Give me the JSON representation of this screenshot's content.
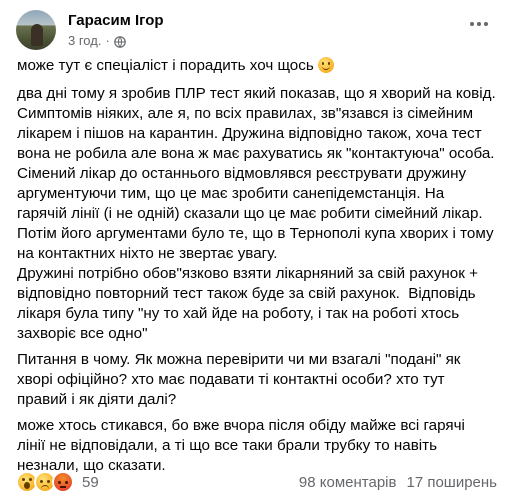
{
  "post": {
    "author": "Гарасим Ігор",
    "time": "3 год.",
    "separator": "·",
    "privacy_icon": "globe-icon",
    "more_icon": "more-options-icon",
    "paragraphs": [
      "може тут є спеціаліст і порадить хоч щось",
      "два дні тому я зробив ПЛР тест який показав, що я хворий на ковід. Симптомів ніяких, але я, по всіх правилах, зв\"язався із сімейним лікарем і пішов на карантин. Дружина відповідно також, хоча тест вона не робила але вона ж має рахуватись як \"контактуюча\" особа.\nСімений лікар до останнього відмовлявся реєструвати дружину аргументуючи тим, що це має зробити санепідемстанція. На гарячій лінії (і не одній) сказали що це має робити сімейний лікар. Потім його аргументами було те, що в Тернополі купа хворих і тому на контактних ніхто не звертає увагу.\nДружині потрібно обов\"язково взяти лікарняний за свій рахунок + відповідно повторний тест також буде за свій рахунок.  Відповідь лікаря була типу \"ну то хай йде на роботу, і так на роботі хтось захворіє все одно\"",
      "Питання в чому. Як можна перевірити чи ми взагалі \"подані\" як хворі офіційно? хто має подавати ті контактні особи? хто тут правий і як діяти далі?",
      "може хтось стикався, бо вже вчора після обіду майже всі гарячі лінії не відповідали, а ті що все таки брали трубку то навіть незнали, що сказати."
    ],
    "first_emoji": "smiling-face-emoji"
  },
  "footer": {
    "reactions": [
      "wow",
      "sad",
      "angry"
    ],
    "reaction_count": "59",
    "comments": "98 коментарів",
    "shares": "17 поширень"
  },
  "colors": {
    "text": "#050505",
    "secondary": "#65676b"
  }
}
